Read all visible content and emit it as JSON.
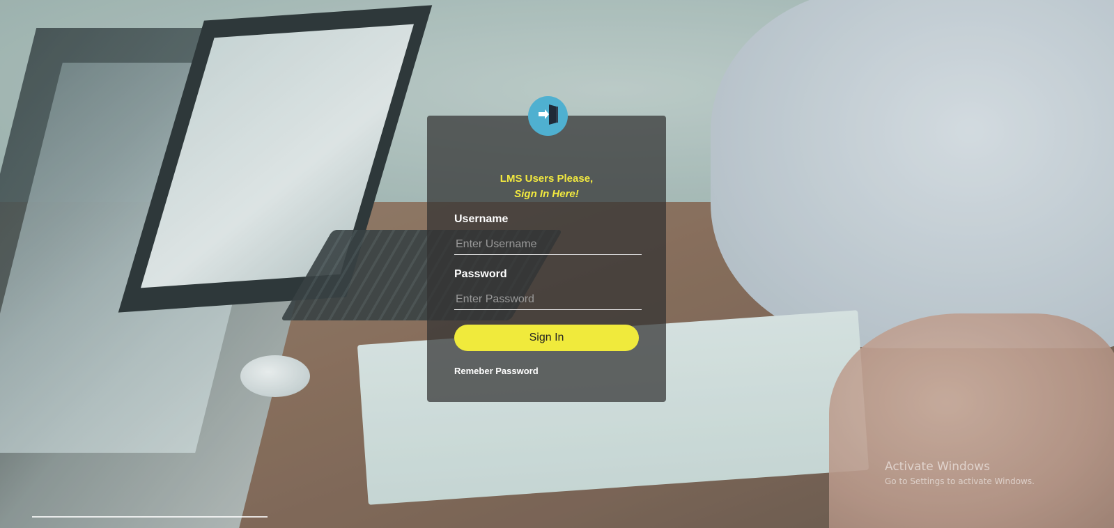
{
  "login": {
    "heading_line1": "LMS Users Please,",
    "heading_line2": "Sign In Here!",
    "username_label": "Username",
    "username_placeholder": "Enter Username",
    "password_label": "Password",
    "password_placeholder": "Enter Password",
    "signin_label": "Sign In",
    "remember_label": "Remeber Password",
    "avatar_icon": "door-enter-icon"
  },
  "watermark": {
    "title": "Activate Windows",
    "subtitle": "Go to Settings to activate Windows."
  },
  "colors": {
    "accent_yellow": "#f0ea3c",
    "heading_yellow": "#f2e93f",
    "avatar_blue": "#4fb0d0",
    "card_bg": "#323232"
  }
}
